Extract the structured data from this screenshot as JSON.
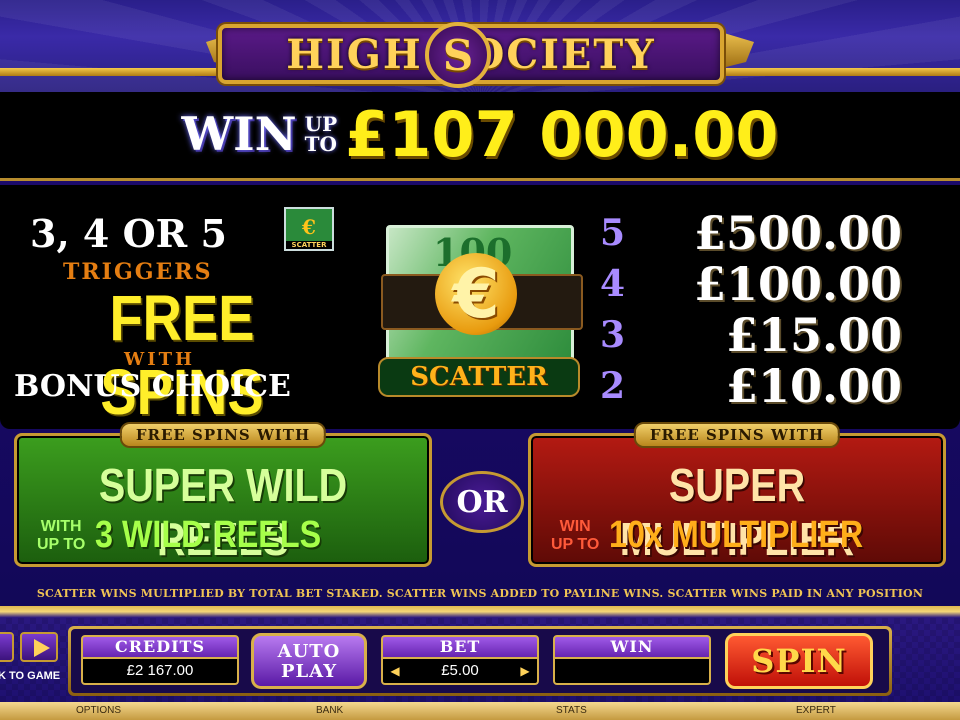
{
  "header": {
    "logo_text": "HIGH SOCIETY",
    "logo_medal": "S",
    "max_win": {
      "prefix": "WIN",
      "upto_1": "UP",
      "upto_2": "TO",
      "amount": "£107 000.00"
    }
  },
  "scatter_info": {
    "trigger_count": "3, 4 OR 5",
    "mini_symbol_label": "SCATTER",
    "mini_symbol_value": "100",
    "triggers": "TRIGGERS",
    "free_spins": "FREE SPINS",
    "with": "WITH",
    "bonus_choice": "BONUS CHOICE",
    "symbol_note_value": "100",
    "symbol_coin": "€",
    "symbol_label": "SCATTER"
  },
  "paytable": [
    {
      "count": "5",
      "value": "£500.00"
    },
    {
      "count": "4",
      "value": "£100.00"
    },
    {
      "count": "3",
      "value": "£15.00"
    },
    {
      "count": "2",
      "value": "£10.00"
    }
  ],
  "features": {
    "left": {
      "tab": "FREE SPINS WITH",
      "title": "SUPER WILD REELS",
      "sub_small_1": "WITH",
      "sub_small_2": "UP TO",
      "sub_big": "3 WILD REELS"
    },
    "or_label": "OR",
    "right": {
      "tab": "FREE SPINS WITH",
      "title": "SUPER MULTIPLIER",
      "sub_small_1": "WIN",
      "sub_small_2": "UP TO",
      "sub_big": "10x MULTIPLIER"
    }
  },
  "disclaimer": "SCATTER WINS MULTIPLIED BY TOTAL BET STAKED. SCATTER WINS ADDED TO PAYLINE WINS. SCATTER WINS PAID IN ANY POSITION",
  "controls": {
    "back_label": "K TO GAME",
    "credits_label": "CREDITS",
    "credits_value": "£2 167.00",
    "autoplay_line1": "AUTO",
    "autoplay_line2": "PLAY",
    "bet_label": "BET",
    "bet_value": "£5.00",
    "win_label": "WIN",
    "win_value": "",
    "spin_label": "SPIN"
  },
  "menu": {
    "options": "OPTIONS",
    "bank": "BANK",
    "stats": "STATS",
    "expert": "EXPERT"
  },
  "colors": {
    "gold": "#d9a530",
    "jackpot_yellow": "#ffee1a",
    "green_panel": "#3c9e1e",
    "red_panel": "#b41a12",
    "purple": "#2a1f8a"
  }
}
